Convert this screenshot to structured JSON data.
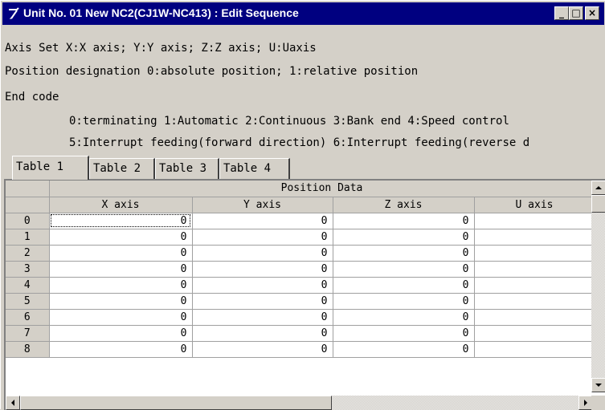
{
  "window": {
    "title": "Unit No. 01 New NC2(CJ1W-NC413) : Edit Sequence",
    "icon": "pencil-icon"
  },
  "title_buttons": {
    "minimize": "_",
    "maximize": "□",
    "close": "×"
  },
  "info": {
    "line1": "Axis Set X:X axis; Y:Y axis; Z:Z axis; U:Uaxis",
    "line2": "Position designation 0:absolute position; 1:relative position",
    "line3": "End code",
    "line4": "0:terminating 1:Automatic 2:Continuous 3:Bank end 4:Speed control",
    "line5": "5:Interrupt feeding(forward direction) 6:Interrupt feeding(reverse d"
  },
  "tabs": [
    {
      "label": "Table 1",
      "active": true
    },
    {
      "label": "Table 2",
      "active": false
    },
    {
      "label": "Table 3",
      "active": false
    },
    {
      "label": "Table 4",
      "active": false
    }
  ],
  "grid": {
    "group_header": "Position Data",
    "columns": [
      "X axis",
      "Y axis",
      "Z axis",
      "U axis"
    ],
    "rows": [
      {
        "index": "0",
        "values": [
          "0",
          "0",
          "0",
          ""
        ]
      },
      {
        "index": "1",
        "values": [
          "0",
          "0",
          "0",
          ""
        ]
      },
      {
        "index": "2",
        "values": [
          "0",
          "0",
          "0",
          ""
        ]
      },
      {
        "index": "3",
        "values": [
          "0",
          "0",
          "0",
          ""
        ]
      },
      {
        "index": "4",
        "values": [
          "0",
          "0",
          "0",
          ""
        ]
      },
      {
        "index": "5",
        "values": [
          "0",
          "0",
          "0",
          ""
        ]
      },
      {
        "index": "6",
        "values": [
          "0",
          "0",
          "0",
          ""
        ]
      },
      {
        "index": "7",
        "values": [
          "0",
          "0",
          "0",
          ""
        ]
      },
      {
        "index": "8",
        "values": [
          "0",
          "0",
          "0",
          ""
        ]
      }
    ]
  }
}
